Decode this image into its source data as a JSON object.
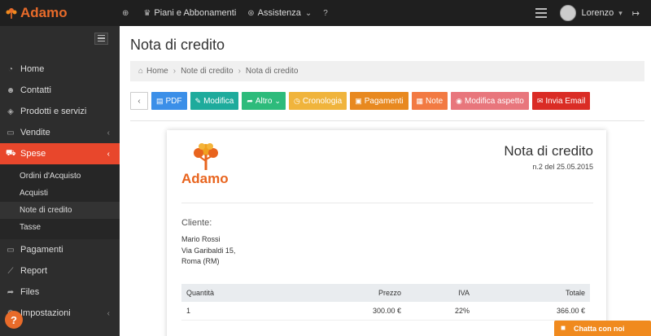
{
  "app": {
    "brand": "Adamo",
    "brand_color": "#e86b2a"
  },
  "topnav": {
    "items": [
      {
        "label": "",
        "icon": "plus-circle-icon"
      },
      {
        "label": "Piani e Abbonamenti",
        "icon": "trophy-icon"
      },
      {
        "label": "Assistenza",
        "icon": "lifebuoy-icon"
      },
      {
        "label": "",
        "icon": "question-icon"
      }
    ],
    "user_name": "Lorenzo"
  },
  "sidebar": {
    "items": [
      {
        "label": "Home",
        "icon": "dashboard-icon"
      },
      {
        "label": "Contatti",
        "icon": "users-icon"
      },
      {
        "label": "Prodotti e servizi",
        "icon": "box-icon"
      },
      {
        "label": "Vendite",
        "icon": "card-icon"
      },
      {
        "label": "Spese",
        "icon": "cart-icon"
      },
      {
        "label": "Pagamenti",
        "icon": "card-icon"
      },
      {
        "label": "Report",
        "icon": "chart-icon"
      },
      {
        "label": "Files",
        "icon": "share-icon"
      },
      {
        "label": "Impostazioni",
        "icon": "gear-icon"
      }
    ],
    "active": "Spese",
    "submenu": [
      "Ordini d'Acquisto",
      "Acquisti",
      "Note di credito",
      "Tasse"
    ],
    "submenu_current": "Note di credito",
    "active_color": "#e8472c"
  },
  "page": {
    "title": "Nota di credito",
    "breadcrumb": [
      "Home",
      "Note di credito",
      "Nota di credito"
    ]
  },
  "toolbar": {
    "pdf": "PDF",
    "modifica": "Modifica",
    "altro": "Altro",
    "cronologia": "Cronologia",
    "pagamenti": "Pagamenti",
    "note": "Note",
    "aspetto": "Modifica aspetto",
    "email": "Invia Email"
  },
  "document": {
    "logo_text": "Adamo",
    "title": "Nota di credito",
    "number": "n.2 del 25.05.2015",
    "client_label": "Cliente:",
    "client_lines": [
      "Mario Rossi",
      "Via Garibaldi 15,",
      "Roma (RM)"
    ],
    "table": {
      "headers": [
        "Quantità",
        "Prezzo",
        "IVA",
        "Totale"
      ],
      "rows": [
        [
          "1",
          "300.00 €",
          "22%",
          "366.00 €"
        ]
      ]
    }
  },
  "chat": {
    "label": "Chatta con noi"
  },
  "help": {
    "label": "?"
  }
}
